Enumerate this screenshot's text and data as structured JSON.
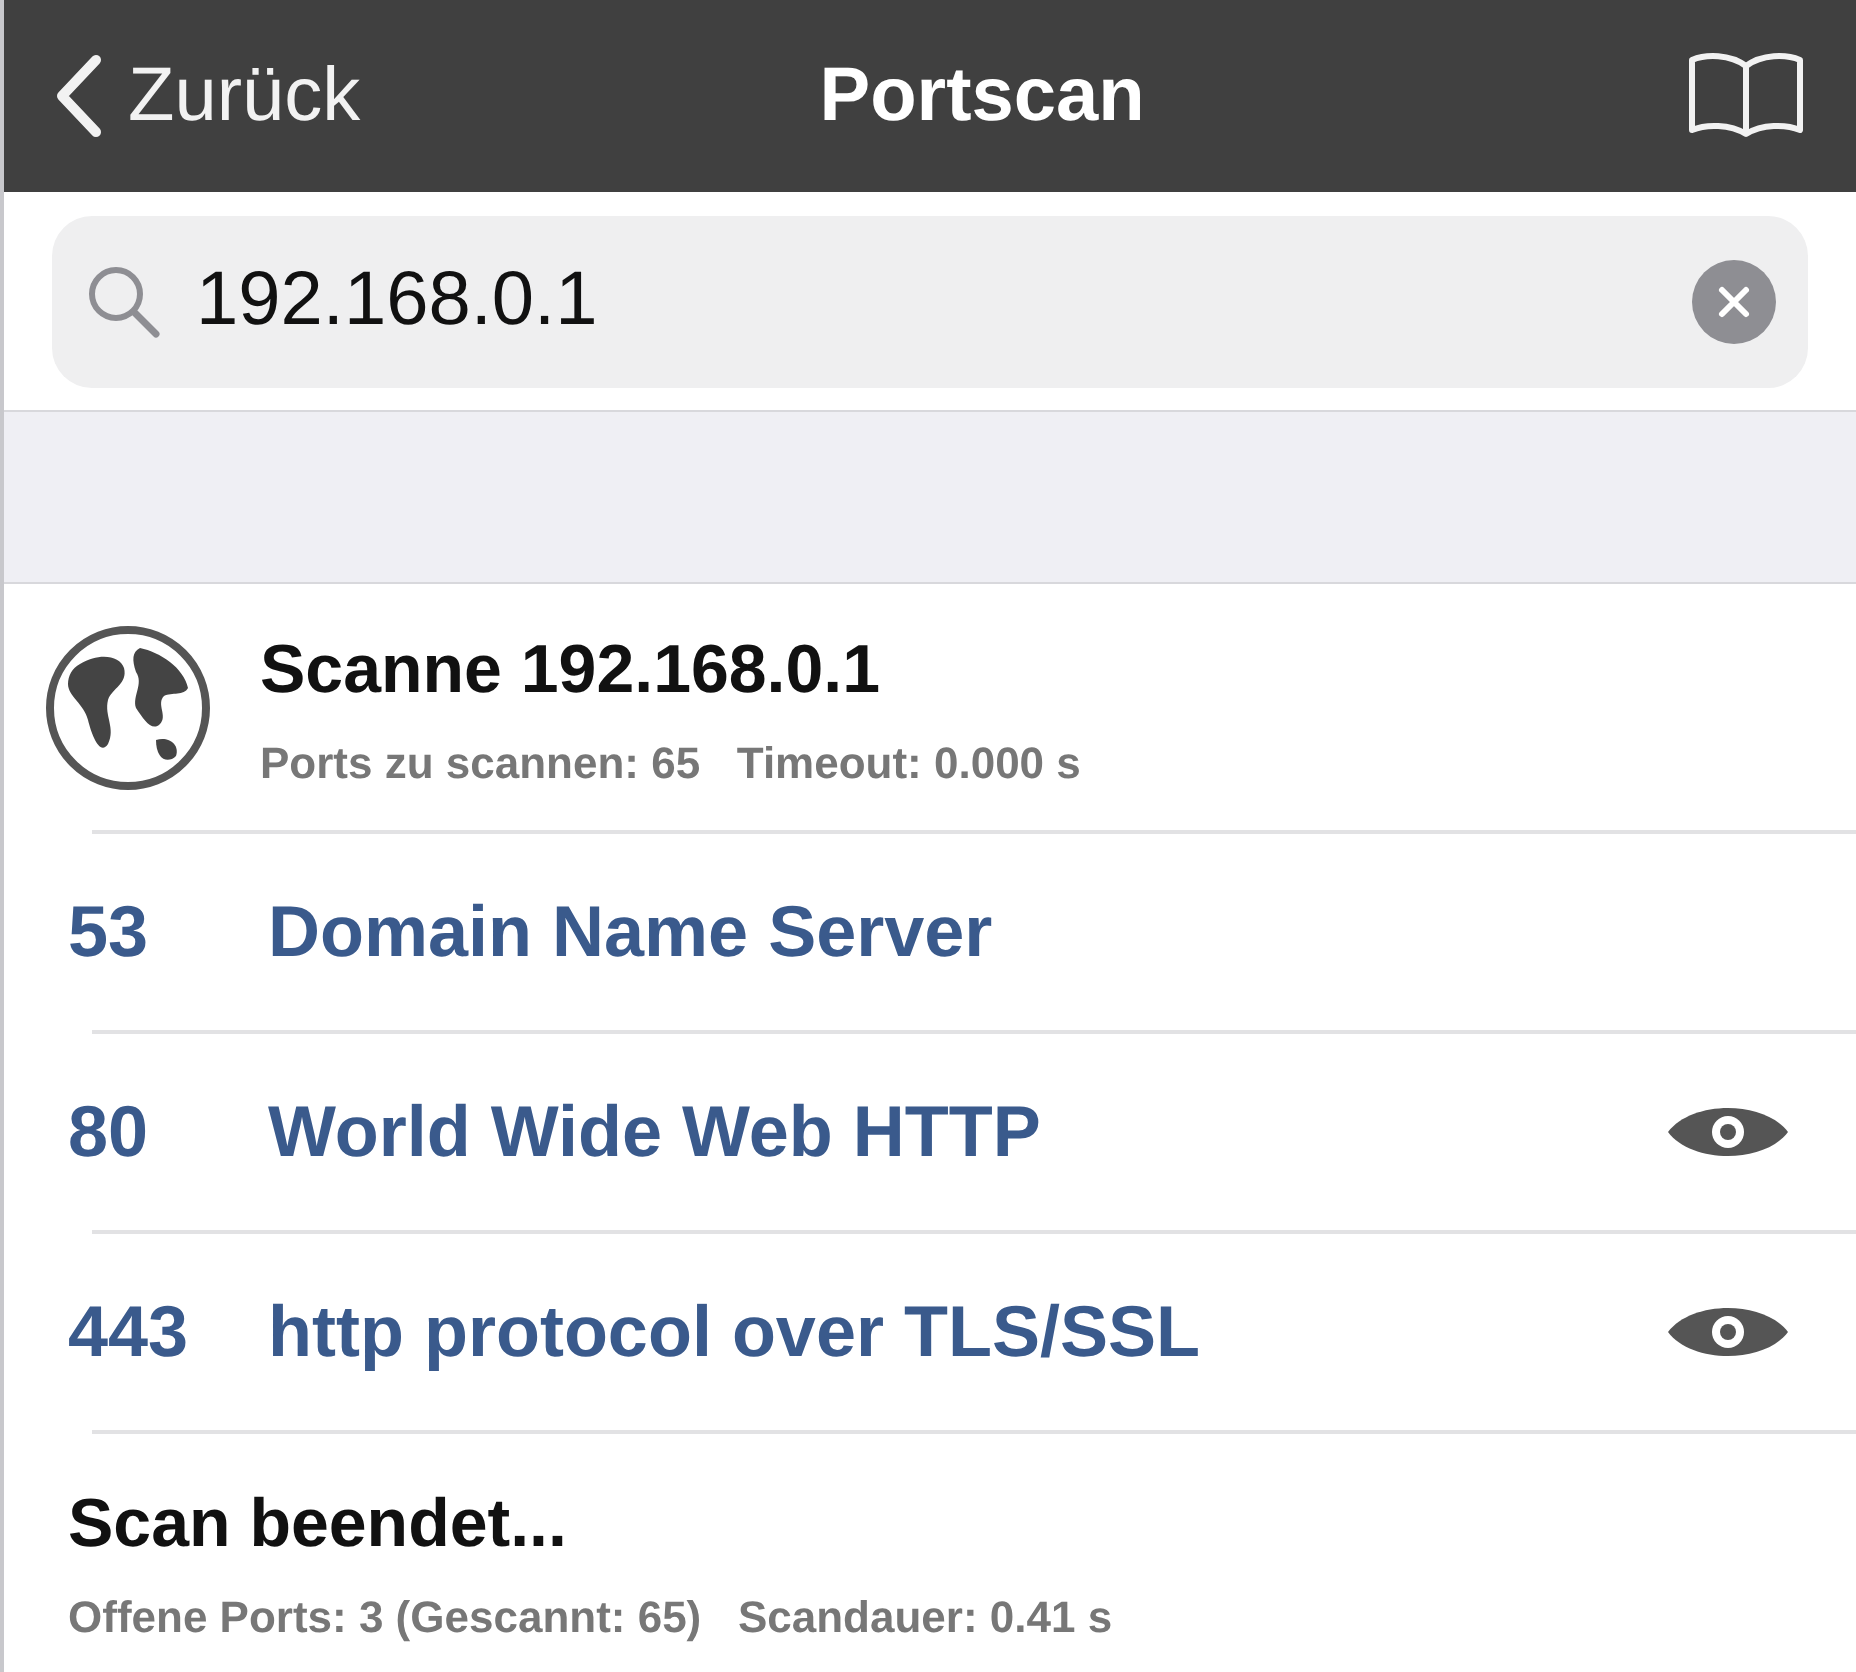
{
  "nav_bar": {
    "back_label": "Zurück",
    "title": "Portscan"
  },
  "search": {
    "value": "192.168.0.1"
  },
  "scan_header": {
    "title": "Scanne 192.168.0.1",
    "details": "Ports zu scannen: 65   Timeout: 0.000 s"
  },
  "ports": [
    {
      "number": "53",
      "service": "Domain Name Server",
      "has_preview": false
    },
    {
      "number": "80",
      "service": "World Wide Web HTTP",
      "has_preview": true
    },
    {
      "number": "443",
      "service": "http protocol over TLS/SSL",
      "has_preview": true
    }
  ],
  "footer": {
    "title": "Scan beendet...",
    "details": "Offene Ports: 3 (Gescannt: 65)   Scandauer: 0.41 s"
  }
}
